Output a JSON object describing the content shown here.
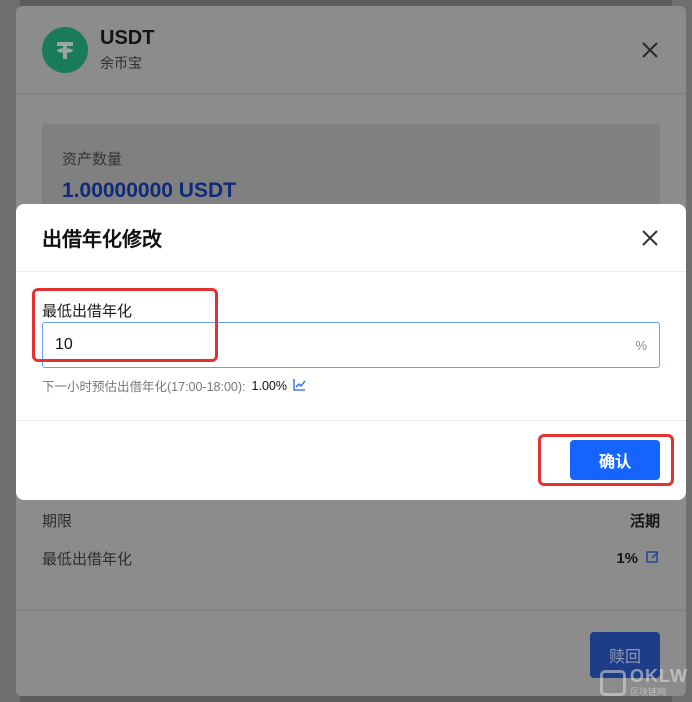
{
  "sheet": {
    "coin_name": "USDT",
    "coin_product": "余币宝",
    "asset_label": "资产数量",
    "asset_value": "1.00000000 USDT",
    "rows": [
      {
        "label": "期限",
        "value": "活期"
      },
      {
        "label": "最低出借年化",
        "value": "1%"
      }
    ],
    "redeem_label": "赎回"
  },
  "dialog": {
    "title": "出借年化修改",
    "field_label": "最低出借年化",
    "input_value": "10",
    "input_suffix": "%",
    "hint_text": "下一小时预估出借年化(17:00-18:00):",
    "hint_value": "1.00%",
    "confirm_label": "确认"
  },
  "colors": {
    "accent": "#1664ff",
    "highlight": "#e23232",
    "coin": "#1a7a5c"
  },
  "watermark": {
    "text": "OKLW",
    "sub": "区块链网"
  }
}
